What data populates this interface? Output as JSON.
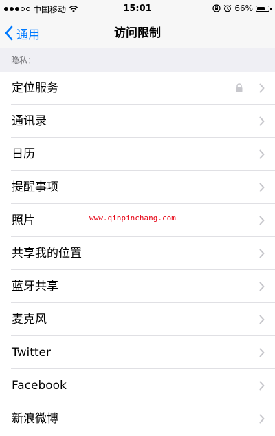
{
  "status_bar": {
    "carrier": "中国移动",
    "time": "15:01",
    "battery_percent": "66%",
    "battery_level": 0.66,
    "signal_bars_filled": 3,
    "signal_bars_total": 5
  },
  "nav": {
    "back_label": "通用",
    "title": "访问限制"
  },
  "section": {
    "header": "隐私："
  },
  "items": [
    {
      "label": "定位服务",
      "locked": true
    },
    {
      "label": "通讯录"
    },
    {
      "label": "日历"
    },
    {
      "label": "提醒事项"
    },
    {
      "label": "照片"
    },
    {
      "label": "共享我的位置"
    },
    {
      "label": "蓝牙共享"
    },
    {
      "label": "麦克风"
    },
    {
      "label": "Twitter"
    },
    {
      "label": "Facebook"
    },
    {
      "label": "新浪微博"
    }
  ],
  "watermark": "www.qinpinchang.com",
  "colors": {
    "accent": "#007aff",
    "watermark": "#e60012",
    "section_background": "#efeff4",
    "chevron": "#c7c7cc"
  },
  "icons": {
    "back": "chevron-left-icon",
    "row": "chevron-right-icon",
    "lock": "lock-icon",
    "wifi": "wifi-icon",
    "orientation_lock": "orientation-lock-icon",
    "alarm": "alarm-icon",
    "battery": "battery-icon"
  }
}
